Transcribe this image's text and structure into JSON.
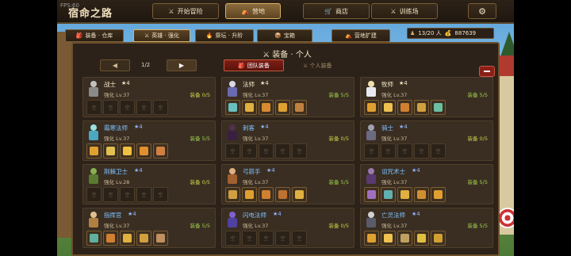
{
  "app": {
    "fps": "FPS:60",
    "title": "宿命之路"
  },
  "topnav": [
    {
      "icon": "crossed-swords-icon",
      "glyph": "⚔",
      "label": "开始冒险",
      "active": false
    },
    {
      "icon": "camp-icon",
      "glyph": "⛺",
      "label": "营地",
      "active": true
    },
    {
      "icon": "shop-icon",
      "glyph": "🛒",
      "label": "商店",
      "active": false
    },
    {
      "icon": "training-icon",
      "glyph": "⚔",
      "label": "训练场",
      "active": false
    }
  ],
  "subtabs": [
    {
      "icon": "bag-icon",
      "glyph": "🎒",
      "label": "装备 · 仓库"
    },
    {
      "icon": "crossed-swords-icon",
      "glyph": "⚔",
      "label": "英雄 · 强化"
    },
    {
      "icon": "altar-icon",
      "glyph": "🔥",
      "label": "祭坛 · 升阶"
    },
    {
      "icon": "box-icon",
      "glyph": "📦",
      "label": "宝箱"
    },
    {
      "icon": "tent-icon",
      "glyph": "⛺",
      "label": "营地扩建"
    }
  ],
  "resources": {
    "heroes": "13/20 人",
    "gold": "887639"
  },
  "panel": {
    "title": "⚔ 装备 · 个人",
    "prev": "◀",
    "next": "▶",
    "page": "1/2",
    "team_label": "团队装备",
    "personal_label": "⚔ 个人装备"
  },
  "colors": {
    "equip_partial": "#c9d24a",
    "equip_full": "#9ccf4c",
    "name_blue": "#7fc2ff"
  },
  "slot_empty_glyph": "空",
  "heroes": [
    {
      "name": "战士",
      "stars": "★4",
      "blue": false,
      "level": "强化 Lv.37",
      "equip": "装备 0/5",
      "full": false,
      "head": "#c0c0c0",
      "body": "#8a8a8a",
      "gems": []
    },
    {
      "name": "法师",
      "stars": "★4",
      "blue": false,
      "level": "强化 Lv.37",
      "equip": "装备 5/5",
      "full": true,
      "head": "#d8d8e8",
      "body": "#6a6ab0",
      "gems": [
        "#68c0c0",
        "#e0b040",
        "#d88a30",
        "#e0a030",
        "#c08040"
      ]
    },
    {
      "name": "牧师",
      "stars": "★4",
      "blue": false,
      "level": "强化 Lv.37",
      "equip": "装备 5/5",
      "full": true,
      "head": "#f0e0b0",
      "body": "#e8e8f0",
      "gems": [
        "#e0a030",
        "#f0c050",
        "#d08030",
        "#d0a040",
        "#6ac0a0"
      ]
    },
    {
      "name": "霜寒法师",
      "stars": "★4",
      "blue": true,
      "level": "强化 Lv.37",
      "equip": "装备 5/5",
      "full": true,
      "head": "#9ae0e0",
      "body": "#4aa8c0",
      "gems": [
        "#e0a030",
        "#e0c050",
        "#f0c040",
        "#e09030",
        "#d08040"
      ]
    },
    {
      "name": "刺客",
      "stars": "★4",
      "blue": true,
      "level": "强化 Lv.37",
      "equip": "装备 0/5",
      "full": false,
      "head": "#503050",
      "body": "#3a2040",
      "gems": []
    },
    {
      "name": "骑士",
      "stars": "★4",
      "blue": true,
      "level": "强化 Lv.37",
      "equip": "装备 0/5",
      "full": false,
      "head": "#a0a0b0",
      "body": "#6a6a80",
      "gems": []
    },
    {
      "name": "荆棘卫士",
      "stars": "★4",
      "blue": true,
      "level": "强化 Lv.28",
      "equip": "装备 0/5",
      "full": false,
      "head": "#8ab050",
      "body": "#5a7a30",
      "gems": []
    },
    {
      "name": "弓箭手",
      "stars": "★4",
      "blue": true,
      "level": "强化 Lv.37",
      "equip": "装备 5/5",
      "full": true,
      "head": "#e0b080",
      "body": "#a06030",
      "gems": [
        "#d0a040",
        "#e0a030",
        "#d08030",
        "#c07030",
        "#e0b040"
      ]
    },
    {
      "name": "诅咒术士",
      "stars": "★4",
      "blue": true,
      "level": "强化 Lv.37",
      "equip": "装备 5/5",
      "full": true,
      "head": "#9a7ab0",
      "body": "#5a3a70",
      "gems": [
        "#a070c0",
        "#60b0b0",
        "#e0b040",
        "#d09030",
        "#e0a030"
      ]
    },
    {
      "name": "指挥官",
      "stars": "★4",
      "blue": true,
      "level": "强化 Lv.37",
      "equip": "装备 5/5",
      "full": true,
      "head": "#e0c090",
      "body": "#b08040",
      "gems": [
        "#60b0a0",
        "#d08030",
        "#e0b040",
        "#d0a040",
        "#c09060"
      ]
    },
    {
      "name": "闪电法师",
      "stars": "★4",
      "blue": true,
      "level": "强化 Lv.37",
      "equip": "装备 0/5",
      "full": false,
      "head": "#8060d0",
      "body": "#5040a0",
      "gems": []
    },
    {
      "name": "亡灵法师",
      "stars": "★4",
      "blue": true,
      "level": "强化 Lv.37",
      "equip": "装备 5/5",
      "full": true,
      "head": "#d0d0d0",
      "body": "#5a5a6a",
      "gems": [
        "#e0a030",
        "#f0c050",
        "#c0a060",
        "#e0c040",
        "#d0a030"
      ]
    }
  ]
}
